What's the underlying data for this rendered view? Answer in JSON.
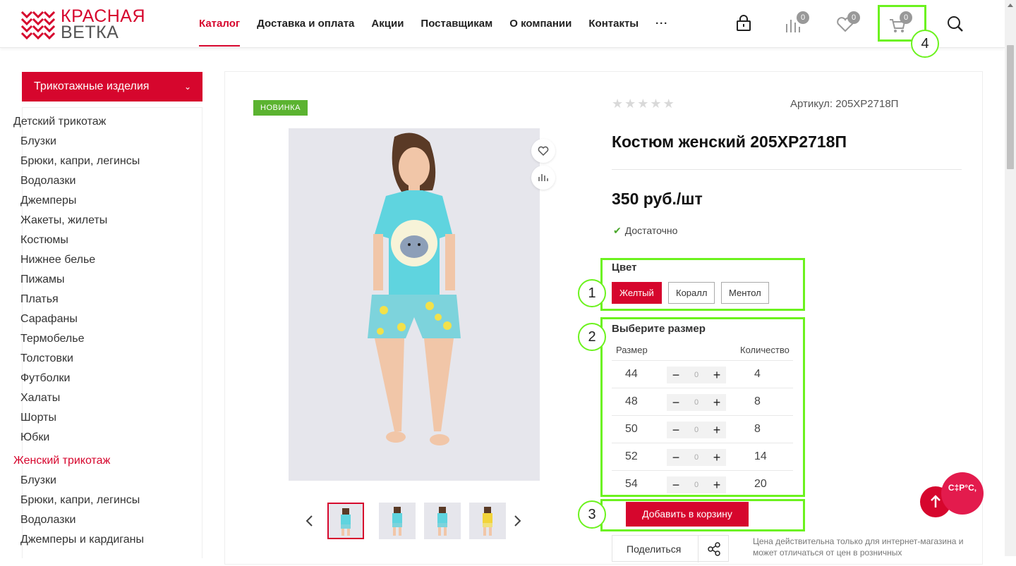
{
  "header": {
    "logo_line1": "КРАСНАЯ",
    "logo_line2": "ВЕТКА",
    "nav": [
      "Каталог",
      "Доставка и оплата",
      "Акции",
      "Поставщикам",
      "О компании",
      "Контакты"
    ],
    "more": "···",
    "compare_count": "0",
    "favorites_count": "0",
    "cart_count": "0"
  },
  "sidebar": {
    "category": "Трикотажные изделия",
    "groups": [
      {
        "title": "Детский трикотаж",
        "items": [
          "Блузки",
          "Брюки, капри, легинсы",
          "Водолазки",
          "Джемперы",
          "Жакеты, жилеты",
          "Костюмы",
          "Нижнее белье",
          "Пижамы",
          "Платья",
          "Сарафаны",
          "Термобелье",
          "Толстовки",
          "Футболки",
          "Халаты",
          "Шорты",
          "Юбки"
        ]
      },
      {
        "title": "Женский трикотаж",
        "items": [
          "Блузки",
          "Брюки, капри, легинсы",
          "Водолазки",
          "Джемперы и кардиганы"
        ]
      }
    ]
  },
  "product": {
    "badge": "НОВИНКА",
    "article": "Артикул: 205ХР2718П",
    "title": "Костюм женский 205ХР2718П",
    "price": "350 руб./шт",
    "stock": "Достаточно",
    "rating": 0,
    "color_label": "Цвет",
    "colors": [
      "Желтый",
      "Коралл",
      "Ментол"
    ],
    "selected_color": "Желтый",
    "size_label": "Выберите размер",
    "col_size": "Размер",
    "col_qty": "Количество",
    "sizes": [
      {
        "size": "44",
        "value": "0",
        "qty": "4"
      },
      {
        "size": "48",
        "value": "0",
        "qty": "8"
      },
      {
        "size": "50",
        "value": "0",
        "qty": "8"
      },
      {
        "size": "52",
        "value": "0",
        "qty": "14"
      },
      {
        "size": "54",
        "value": "0",
        "qty": "20"
      }
    ],
    "add_to_cart": "Добавить в корзину",
    "share": "Поделиться",
    "note": "Цена действительна только для интернет-магазина и может отличаться от цен в розничных"
  },
  "annotations": [
    "1",
    "2",
    "3",
    "4"
  ],
  "chat_text": "С‡Р°С‚"
}
